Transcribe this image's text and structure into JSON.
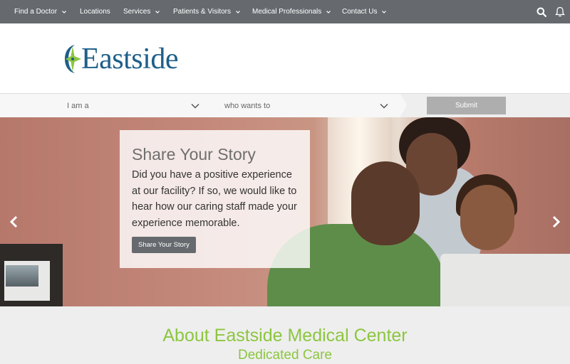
{
  "nav": {
    "items": [
      {
        "label": "Find a Doctor",
        "has_dropdown": true
      },
      {
        "label": "Locations",
        "has_dropdown": false
      },
      {
        "label": "Services",
        "has_dropdown": true
      },
      {
        "label": "Patients & Visitors",
        "has_dropdown": true
      },
      {
        "label": "Medical Professionals",
        "has_dropdown": true
      },
      {
        "label": "Contact Us",
        "has_dropdown": true
      }
    ],
    "icons": [
      "search-icon",
      "bell-icon"
    ],
    "background": "#666a6e"
  },
  "logo": {
    "text": "Eastside",
    "color": "#1e5f8a",
    "accent": "#8cc63f"
  },
  "selector": {
    "i_am": "I am a",
    "wants_to": "who wants to",
    "submit": "Submit"
  },
  "hero": {
    "title": "Share Your Story",
    "body": "Did you have a positive experience at our facility? If so, we would like to hear how our caring staff made your experience memorable.",
    "button": "Share Your Story",
    "prev_icon": "chevron-left-icon",
    "next_icon": "chevron-right-icon"
  },
  "about": {
    "title": "About Eastside Medical Center",
    "subtitle": "Dedicated Care",
    "color": "#8cc63f"
  }
}
